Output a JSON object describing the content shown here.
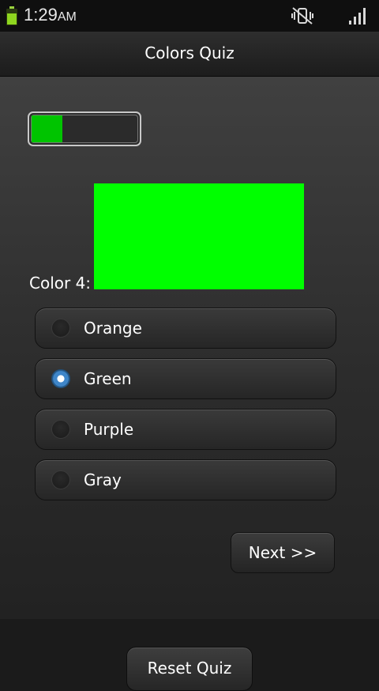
{
  "status_bar": {
    "time": "1:29",
    "ampm": "AM"
  },
  "header": {
    "title": "Colors Quiz"
  },
  "quiz": {
    "progress_fraction": 0.29,
    "progress_color": "#00c400",
    "question_label": "Color 4:",
    "swatch_color": "#00ff00",
    "options": [
      {
        "label": "Orange",
        "selected": false
      },
      {
        "label": "Green",
        "selected": true
      },
      {
        "label": "Purple",
        "selected": false
      },
      {
        "label": "Gray",
        "selected": false
      }
    ],
    "next_label": "Next >>",
    "reset_label": "Reset Quiz"
  },
  "icons": {
    "battery": "battery-icon",
    "mute": "vibrate-mute-icon",
    "signal": "signal-strength-icon"
  }
}
